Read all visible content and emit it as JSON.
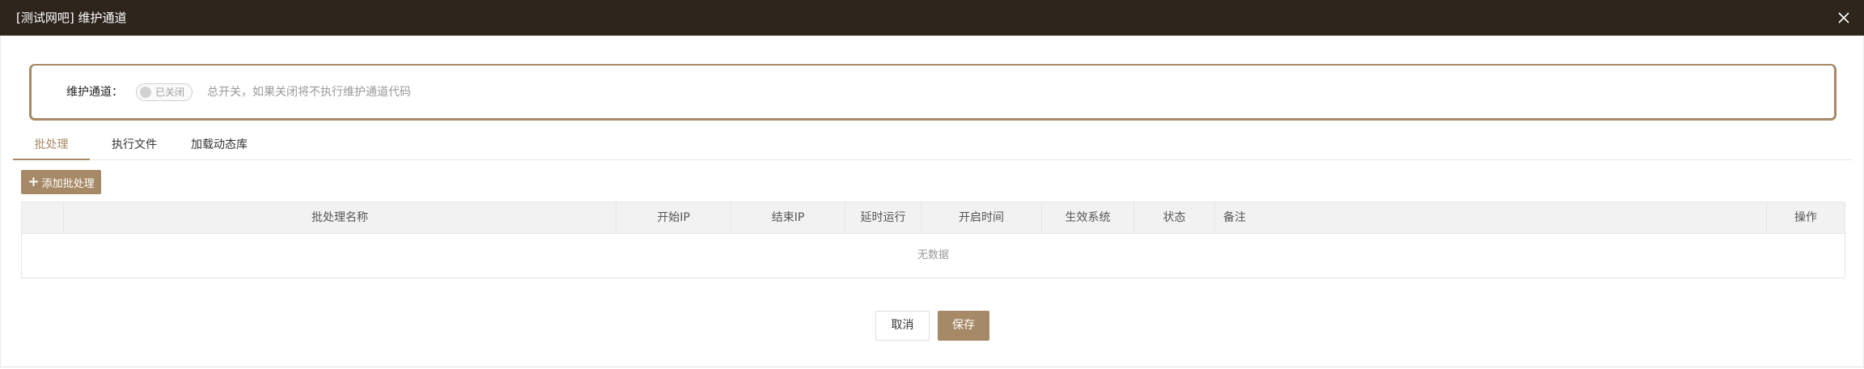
{
  "window": {
    "title": "[测试网吧] 维护通道",
    "close_icon": "close-icon"
  },
  "maintenance": {
    "label": "维护通道：",
    "switch_text": "已关闭",
    "switch_on": false,
    "hint": "总开关，如果关闭将不执行维护通道代码"
  },
  "tabs": [
    {
      "label": "批处理",
      "active": true
    },
    {
      "label": "执行文件",
      "active": false
    },
    {
      "label": "加载动态库",
      "active": false
    }
  ],
  "toolbar": {
    "add_label": "添加批处理",
    "add_icon": "plus-icon"
  },
  "table": {
    "columns": [
      "",
      "批处理名称",
      "开始IP",
      "结束IP",
      "延时运行",
      "开启时间",
      "生效系统",
      "状态",
      "备注",
      "操作"
    ],
    "rows": [],
    "empty_text": "无数据"
  },
  "footer": {
    "cancel_label": "取消",
    "save_label": "保存"
  },
  "colors": {
    "accent": "#a68966",
    "titlebar": "#2d241c"
  }
}
